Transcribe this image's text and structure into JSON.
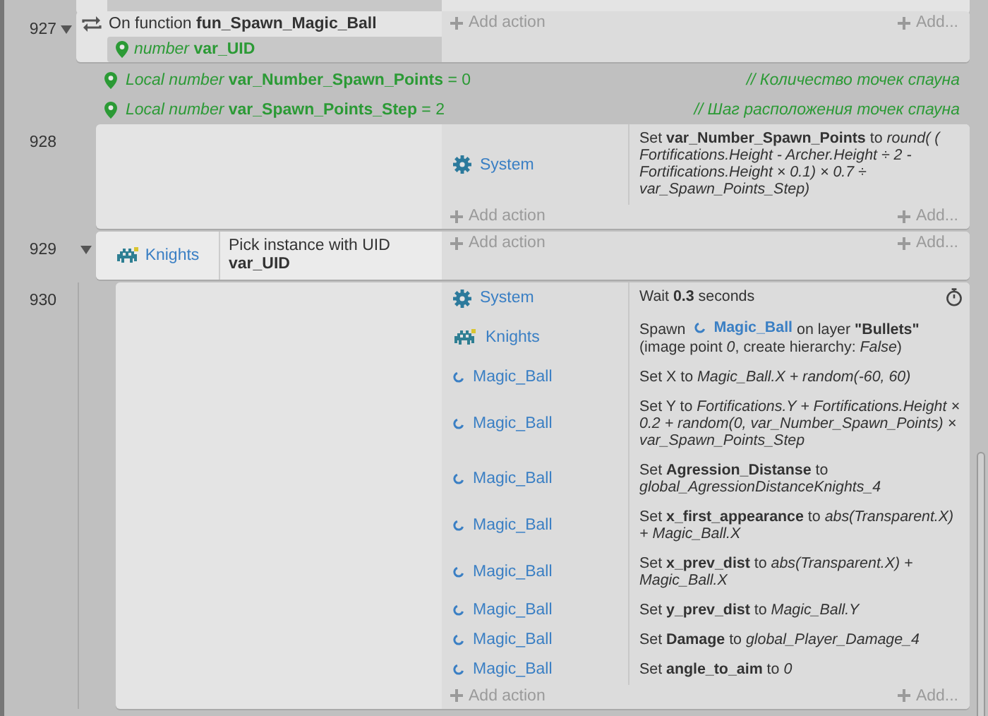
{
  "events": [
    {
      "number": "927",
      "expanded": true,
      "add_action": "Add action",
      "add_more": "Add...",
      "conditions": [
        {
          "kind": "function",
          "text": "On function **fun_Spawn_Magic_Ball**",
          "parameters": [
            "*number* **var_UID**"
          ]
        }
      ],
      "local_variables": [
        {
          "text": "*Local number* **var_Number_Spawn_Points** = 0",
          "comment": "// Количество точек спауна"
        },
        {
          "text": "*Local number* **var_Spawn_Points_Step** = 2",
          "comment": "// Шаг расположения точек спауна"
        }
      ],
      "children": [
        {
          "number": "928",
          "add_action": "Add action",
          "add_more": "Add...",
          "actions": [
            {
              "kind": "plain",
              "object": {
                "name": "System",
                "kind": "system"
              },
              "text": "Set **var_Number_Spawn_Points** to *round( ( Fortifications.Height - Archer.Height ÷ 2 - Fortifications.Height × 0.1) × 0.7 ÷ var_Spawn_Points_Step)*"
            }
          ]
        },
        {
          "number": "929",
          "expanded": true,
          "add_action": "Add action",
          "add_more": "Add...",
          "conditions": [
            {
              "kind": "object",
              "object": {
                "name": "Knights",
                "kind": "sprite"
              },
              "text": "Pick instance with UID\n**var_UID**"
            }
          ],
          "children": [
            {
              "number": "930",
              "add_action": "Add action",
              "add_more": "Add...",
              "actions": [
                {
                  "kind": "wait",
                  "object": {
                    "name": "System",
                    "kind": "system"
                  },
                  "text": "Wait **0.3** seconds"
                },
                {
                  "kind": "spawn",
                  "object": {
                    "name": "Knights",
                    "kind": "sprite"
                  },
                  "text": "Spawn",
                  "target": {
                    "name": "Magic_Ball",
                    "kind": "particles"
                  },
                  "text_after": "on layer **\"Bullets\"**",
                  "detail": "(image point *0*, create hierarchy: *False*)"
                },
                {
                  "kind": "plain",
                  "object": {
                    "name": "Magic_Ball",
                    "kind": "particles"
                  },
                  "text": "Set X to *Magic_Ball.X + random(-60, 60)*"
                },
                {
                  "kind": "plain",
                  "object": {
                    "name": "Magic_Ball",
                    "kind": "particles"
                  },
                  "text": "Set Y to *Fortifications.Y + Fortifications.Height × 0.2 + random(0, var_Number_Spawn_Points) × var_Spawn_Points_Step*"
                },
                {
                  "kind": "plain",
                  "object": {
                    "name": "Magic_Ball",
                    "kind": "particles"
                  },
                  "text": "Set **Agression_Distanse** to *global_AgressionDistanceKnights_4*"
                },
                {
                  "kind": "plain",
                  "object": {
                    "name": "Magic_Ball",
                    "kind": "particles"
                  },
                  "text": "Set **x_first_appearance** to *abs(Transparent.X) + Magic_Ball.X*"
                },
                {
                  "kind": "plain",
                  "object": {
                    "name": "Magic_Ball",
                    "kind": "particles"
                  },
                  "text": "Set **x_prev_dist** to *abs(Transparent.X) + Magic_Ball.X*"
                },
                {
                  "kind": "plain",
                  "object": {
                    "name": "Magic_Ball",
                    "kind": "particles"
                  },
                  "text": "Set **y_prev_dist** to *Magic_Ball.Y*"
                },
                {
                  "kind": "plain",
                  "object": {
                    "name": "Magic_Ball",
                    "kind": "particles"
                  },
                  "text": "Set **Damage** to *global_Player_Damage_4*"
                },
                {
                  "kind": "plain",
                  "object": {
                    "name": "Magic_Ball",
                    "kind": "particles"
                  },
                  "text": "Set **angle_to_aim** to *0*"
                }
              ]
            }
          ]
        }
      ]
    }
  ]
}
